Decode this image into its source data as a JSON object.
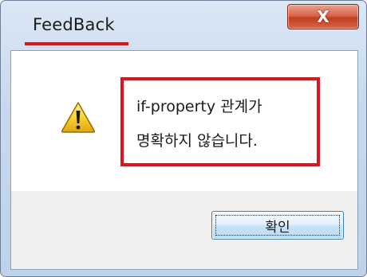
{
  "window": {
    "title": "FeedBack",
    "close_glyph": "X"
  },
  "dialog": {
    "icon": "warning-icon",
    "message_line1": "if-property 관계가",
    "message_line2": "명확하지 않습니다.",
    "ok_label": "확인"
  },
  "colors": {
    "highlight_red": "#e3121a",
    "close_button_red": "#c23f21",
    "frame_blue": "#c7d8ee",
    "button_blue": "#3c7fb1"
  }
}
